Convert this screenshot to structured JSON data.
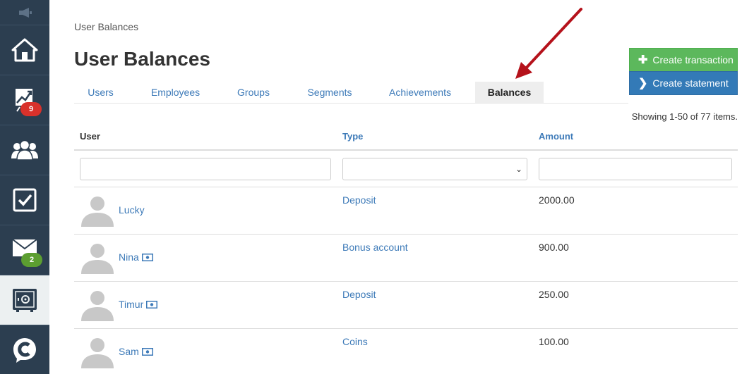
{
  "sidebar": {
    "items": [
      {
        "name": "home",
        "icon": "home-icon"
      },
      {
        "name": "analytics",
        "icon": "chart-icon",
        "badge": "9",
        "badge_color": "#d9312b"
      },
      {
        "name": "users",
        "icon": "people-icon"
      },
      {
        "name": "tasks",
        "icon": "checkbox-icon"
      },
      {
        "name": "messages",
        "icon": "envelope-icon",
        "badge": "2",
        "badge_color": "#5c9e31"
      },
      {
        "name": "balances",
        "icon": "safe-icon",
        "active": true
      },
      {
        "name": "logo",
        "icon": "chat-logo-icon"
      }
    ]
  },
  "breadcrumb": "User Balances",
  "title": "User Balances",
  "tabs": [
    {
      "label": "Users"
    },
    {
      "label": "Employees"
    },
    {
      "label": "Groups"
    },
    {
      "label": "Segments"
    },
    {
      "label": "Achievements"
    },
    {
      "label": "Balances",
      "active": true
    }
  ],
  "buttons": {
    "create_transaction": "Create transaction",
    "create_statement": "Create statement"
  },
  "summary": "Showing 1-50 of 77 items.",
  "table": {
    "headers": {
      "user": "User",
      "type": "Type",
      "amount": "Amount"
    },
    "filters": {
      "user": "",
      "type": "",
      "amount": ""
    },
    "rows": [
      {
        "user": "Lucky",
        "type": "Deposit",
        "amount": "2000.00",
        "money_icon": false
      },
      {
        "user": "Nina",
        "type": "Bonus account",
        "amount": "900.00",
        "money_icon": true
      },
      {
        "user": "Timur",
        "type": "Deposit",
        "amount": "250.00",
        "money_icon": true
      },
      {
        "user": "Sam",
        "type": "Coins",
        "amount": "100.00",
        "money_icon": true
      }
    ]
  },
  "colors": {
    "sidebar": "#2c3e50",
    "accent": "#3d7ab8",
    "green": "#5cb85c",
    "blue": "#337ab7",
    "annotation_arrow": "#b5121b"
  }
}
